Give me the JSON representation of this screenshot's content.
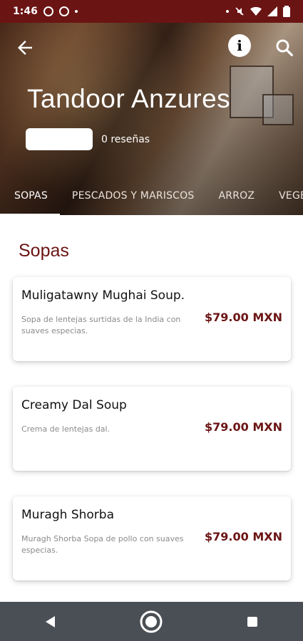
{
  "status_bar": {
    "time": "1:46"
  },
  "header": {
    "restaurant_name": "Tandoor Anzures",
    "reviews": "0 reseñas",
    "tabs": [
      {
        "label": "SOPAS",
        "active": true
      },
      {
        "label": "PESCADOS Y MARISCOS",
        "active": false
      },
      {
        "label": "ARROZ",
        "active": false
      },
      {
        "label": "VEGET",
        "active": false
      }
    ]
  },
  "menu": {
    "section_title": "Sopas",
    "items": [
      {
        "name": "Muligatawny Mughai Soup.",
        "description": "Sopa de lentejas surtidas de la India con suaves especias.",
        "price": "$79.00 MXN"
      },
      {
        "name": " Creamy Dal Soup",
        "description": "Crema de lentejas dal.",
        "price": "$79.00 MXN"
      },
      {
        "name": "Muragh Shorba",
        "description": " Muragh Shorba   Sopa de pollo con suaves especias.",
        "price": "$79.00 MXN"
      }
    ]
  },
  "colors": {
    "brand": "#6b1414",
    "nav_bar": "#4a4f55"
  },
  "icons": {
    "back": "arrow-left-icon",
    "info": "info-icon",
    "search": "search-icon"
  }
}
